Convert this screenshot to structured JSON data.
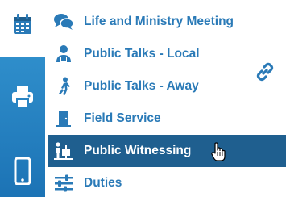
{
  "menu": {
    "items": [
      {
        "label": "Life and Ministry Meeting",
        "icon": "comments-icon"
      },
      {
        "label": "Public Talks - Local",
        "icon": "speaker-icon"
      },
      {
        "label": "Public Talks - Away",
        "icon": "walking-person-icon"
      },
      {
        "label": "Field Service",
        "icon": "door-icon"
      },
      {
        "label": "Public Witnessing",
        "icon": "cart-witnessing-icon"
      },
      {
        "label": "Duties",
        "icon": "sliders-icon"
      }
    ],
    "active_index": 4
  },
  "rail": {
    "icons": [
      "calendar-icon",
      "printer-icon",
      "mobile-phone-icon"
    ]
  },
  "colors": {
    "accent": "#2a7ab7",
    "active_bg": "#1f5f8f",
    "rail_gradient_top": "#2f8ecb",
    "rail_gradient_bottom": "#1c73b5"
  }
}
